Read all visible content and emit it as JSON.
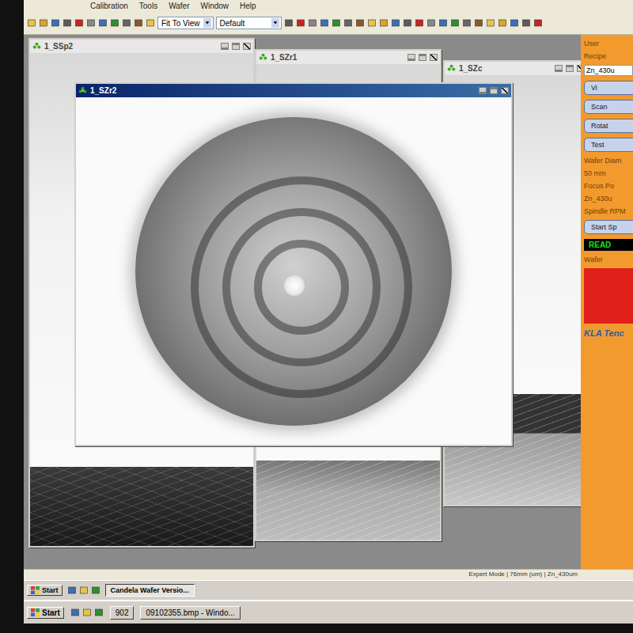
{
  "menu": [
    "Calibration",
    "Tools",
    "Wafer",
    "Window",
    "Help"
  ],
  "toolbar": {
    "zoom": "Fit To View",
    "palette": "Default"
  },
  "windows": [
    {
      "title": "1_SSp2",
      "kind": "scan",
      "active": false
    },
    {
      "title": "1_SZr1",
      "kind": "scan",
      "active": false
    },
    {
      "title": "1_SZc",
      "kind": "scan",
      "active": false
    },
    {
      "title": "1_SZr2",
      "kind": "wafer",
      "active": true
    }
  ],
  "side_panel": {
    "header": "User",
    "recipe_label": "Recipe",
    "recipe": "Zn_430u",
    "buttons": [
      "Vi",
      "Scan",
      "Rotat",
      "Test"
    ],
    "wafer_diameter_label": "Wafer Diam",
    "wafer_diameter": "50 mm",
    "focus_label": "Focus Po",
    "focus": "Zn_430u",
    "spindle_label": "Spindle RPM",
    "start_button": "Start Sp",
    "status": "READ",
    "wafer_label": "Wafer",
    "logo": "KLA Tenc"
  },
  "status_bar": "Expert Mode | 76mm (um) | Zn_430um",
  "app_taskbar": {
    "start": "Start",
    "items": [
      {
        "label": "Candela Wafer Versio...",
        "selected": true
      }
    ]
  },
  "os_taskbar": {
    "start": "Start",
    "items": [
      {
        "label": "902",
        "selected": false
      },
      {
        "label": "09102355.bmp - Windo...",
        "selected": false
      }
    ]
  }
}
